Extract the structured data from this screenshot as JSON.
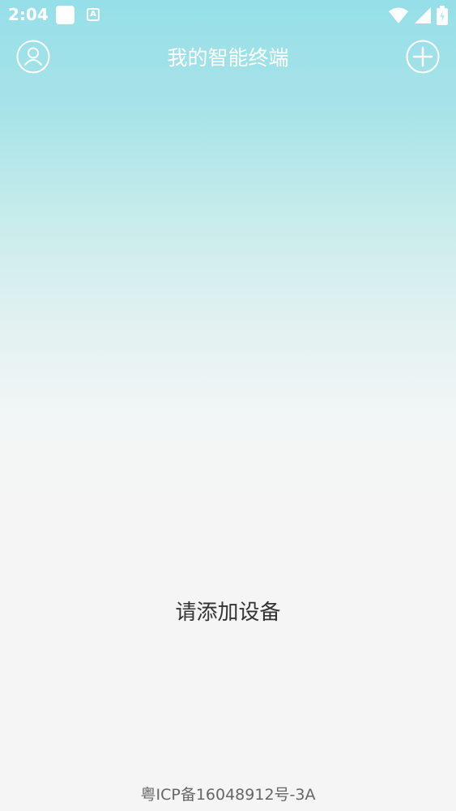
{
  "status_bar": {
    "time": "2:04",
    "notification_letter": "A",
    "icons": [
      "app-notification-icon",
      "keyboard-a-icon",
      "wifi-icon",
      "cellular-signal-icon",
      "battery-charging-icon"
    ]
  },
  "header": {
    "title": "我的智能终端",
    "left_icon": "user-profile-icon",
    "right_icon": "add-circle-icon"
  },
  "main": {
    "empty_message": "请添加设备"
  },
  "footer": {
    "icp": "粤ICP备16048912号-3A"
  },
  "colors": {
    "gradient_top": "#96dfe8",
    "background": "#f5f5f5",
    "header_foreground": "#ffffff",
    "empty_text": "#333333",
    "footer_text": "#666666"
  }
}
